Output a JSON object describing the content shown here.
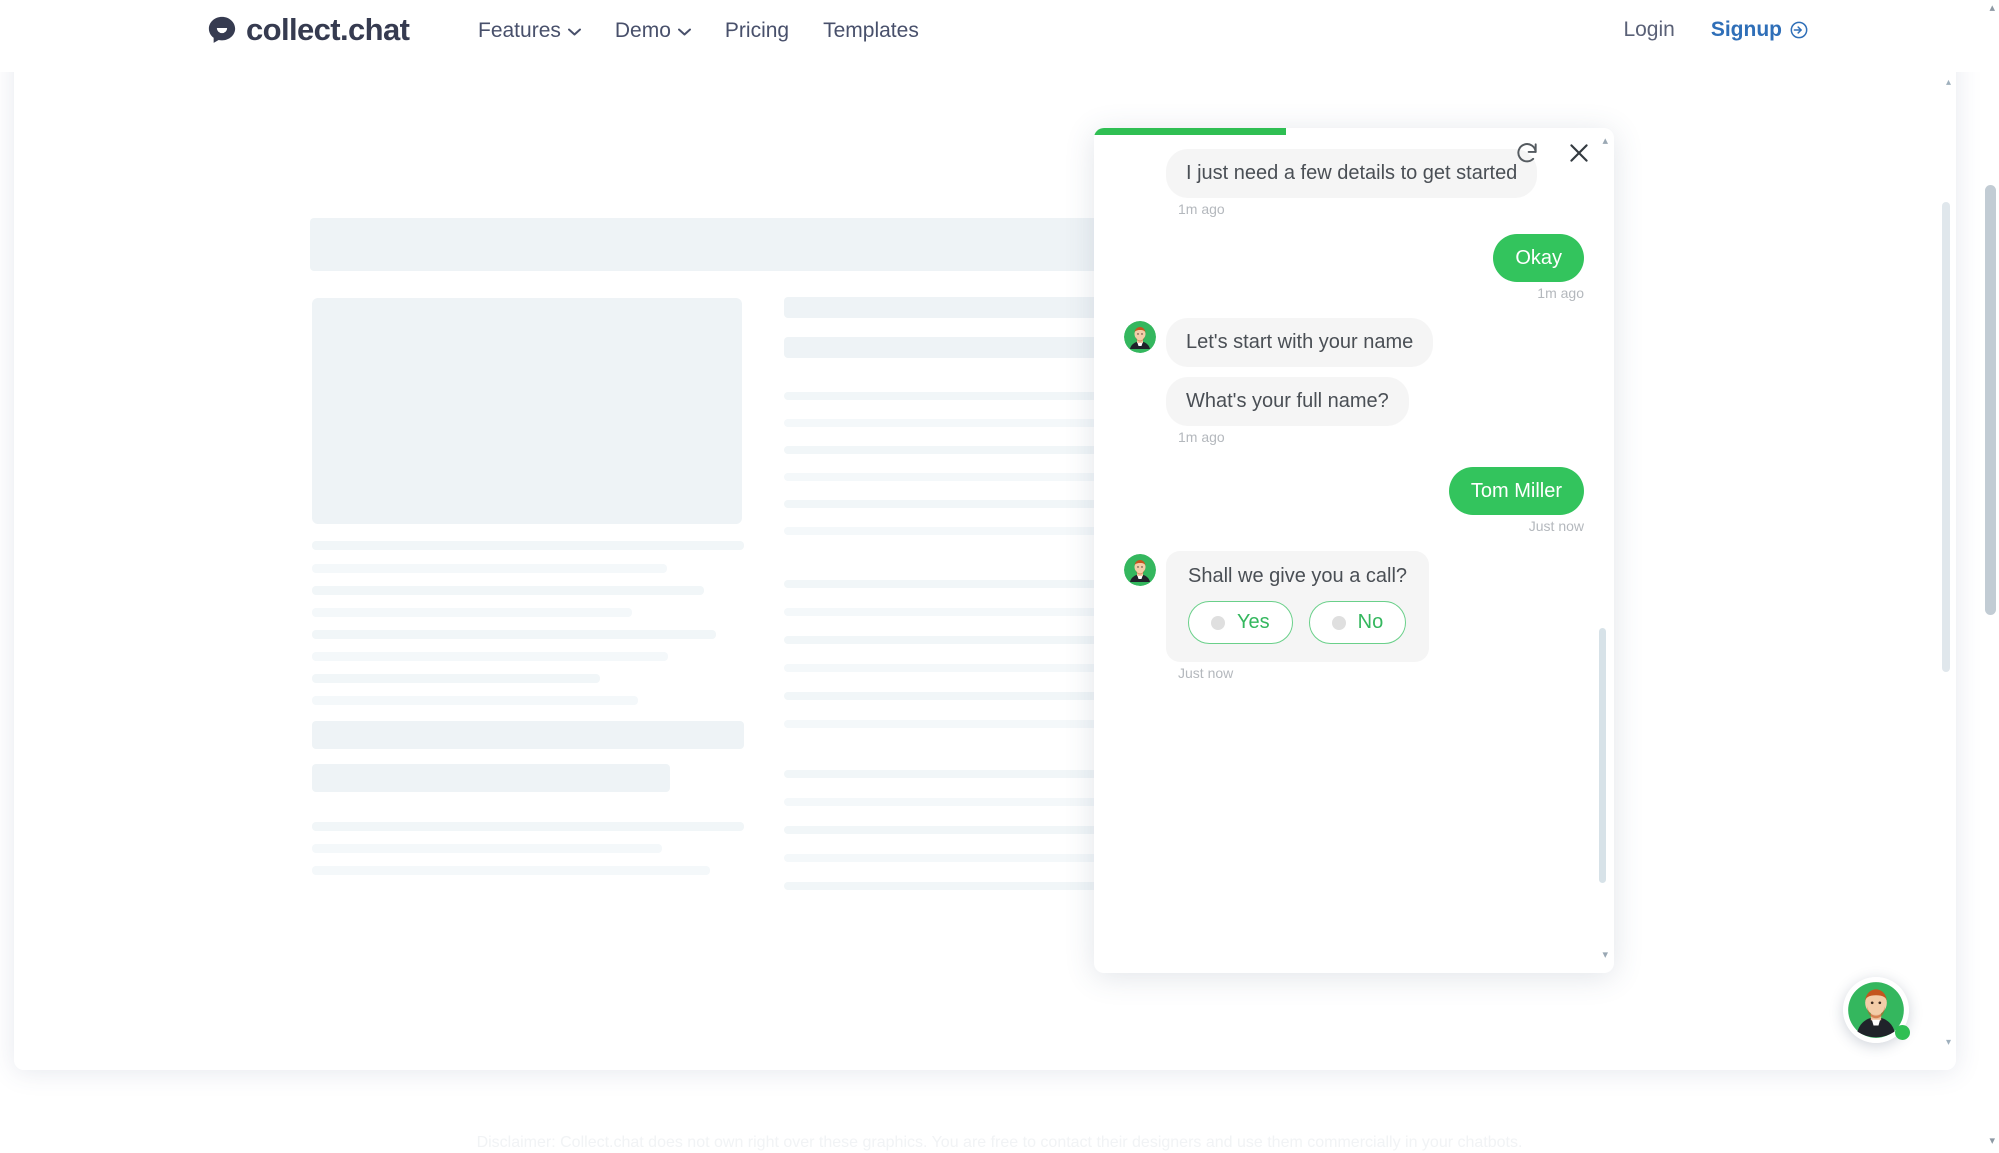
{
  "header": {
    "brand": {
      "logo_icon": "chat-bubble-logo-icon",
      "name": "collect.chat"
    },
    "nav": [
      {
        "label": "Features",
        "has_dropdown": true
      },
      {
        "label": "Demo",
        "has_dropdown": true
      },
      {
        "label": "Pricing",
        "has_dropdown": false
      },
      {
        "label": "Templates",
        "has_dropdown": false
      }
    ],
    "auth": {
      "login_label": "Login",
      "signup_label": "Signup",
      "signup_icon": "arrow-right-circle-icon"
    }
  },
  "browser_mock": {
    "window_dots": [
      "close-dot",
      "minimize-dot",
      "maximize-dot"
    ],
    "scroll_up_arrow": "▴",
    "scroll_down_arrow": "▾"
  },
  "chat": {
    "progress_percent": 37,
    "controls": {
      "restart_icon": "refresh-icon",
      "close_icon": "close-icon"
    },
    "messages": [
      {
        "side": "bot",
        "type": "text",
        "text": "I just need a few details to get started",
        "timestamp": "1m ago",
        "show_avatar": false
      },
      {
        "side": "user",
        "type": "text",
        "text": "Okay",
        "timestamp": "1m ago"
      },
      {
        "side": "bot",
        "type": "text",
        "text": "Let's start with your name",
        "show_avatar": true,
        "timestamp": ""
      },
      {
        "side": "bot",
        "type": "text",
        "text": "What's your full name?",
        "show_avatar": false,
        "timestamp": "1m ago"
      },
      {
        "side": "user",
        "type": "text",
        "text": "Tom Miller",
        "timestamp": "Just now"
      },
      {
        "side": "bot",
        "type": "choice",
        "question": "Shall we give you a call?",
        "options": [
          "Yes",
          "No"
        ],
        "show_avatar": true,
        "timestamp": "Just now"
      }
    ],
    "scroll_up_caret": "▴",
    "scroll_down_caret": "▾"
  },
  "launcher": {
    "avatar_icon": "agent-avatar-icon",
    "status": "online"
  },
  "footer": {
    "disclaimer": "Disclaimer: Collect.chat does not own right over these graphics. You are free to contact their designers and use them commercially in your chatbots."
  },
  "colors": {
    "brand_green": "#33c45d",
    "progress_green": "#2fbf53",
    "brand_dark": "#363b50",
    "link_blue": "#2f6fb8",
    "bot_bubble": "#f5f5f5",
    "skeleton": "#eef3f6"
  }
}
